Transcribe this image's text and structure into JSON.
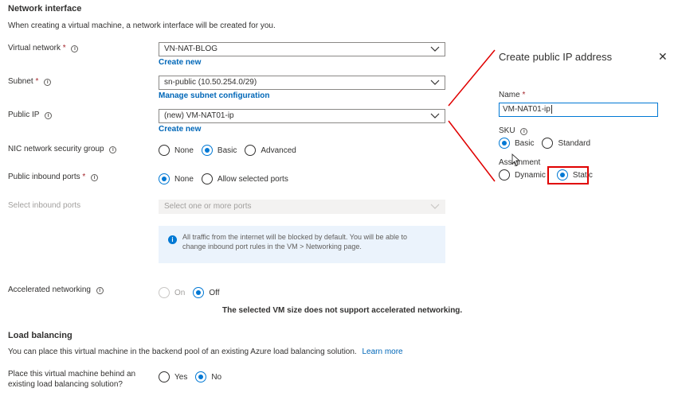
{
  "network_interface": {
    "title": "Network interface",
    "description": "When creating a virtual machine, a network interface will be created for you."
  },
  "virtual_network": {
    "label": "Virtual network",
    "required": "*",
    "value": "VN-NAT-BLOG",
    "link": "Create new"
  },
  "subnet": {
    "label": "Subnet",
    "required": "*",
    "value": "sn-public (10.50.254.0/29)",
    "link": "Manage subnet configuration"
  },
  "public_ip": {
    "label": "Public IP",
    "value": "(new) VM-NAT01-ip",
    "link": "Create new"
  },
  "nic_nsg": {
    "label": "NIC network security group",
    "options": [
      "None",
      "Basic",
      "Advanced"
    ],
    "selected": "Basic"
  },
  "public_inbound_ports": {
    "label": "Public inbound ports",
    "required": "*",
    "options": [
      "None",
      "Allow selected ports"
    ],
    "selected": "None"
  },
  "select_inbound_ports": {
    "label": "Select inbound ports",
    "placeholder": "Select one or more ports"
  },
  "info_box": {
    "line1": "All traffic from the internet will be blocked by default. You will be able to",
    "line2": "change inbound port rules in the VM > Networking page."
  },
  "accelerated_networking": {
    "label": "Accelerated networking",
    "options": [
      "On",
      "Off"
    ],
    "selected": "Off",
    "note": "The selected VM size does not support accelerated networking."
  },
  "load_balancing": {
    "title": "Load balancing",
    "description": "You can place this virtual machine in the backend pool of an existing Azure load balancing solution.",
    "learn_more": "Learn more",
    "question_line1": "Place this virtual machine behind an",
    "question_line2": "existing load balancing solution?",
    "options": [
      "Yes",
      "No"
    ],
    "selected": "No"
  },
  "panel": {
    "title": "Create public IP address",
    "name_label": "Name",
    "name_required": "*",
    "name_value": "VM-NAT01-ip",
    "sku_label": "SKU",
    "sku_options": [
      "Basic",
      "Standard"
    ],
    "sku_selected": "Basic",
    "assignment_label": "Assignment",
    "assignment_options": [
      "Dynamic",
      "Static"
    ],
    "assignment_selected": "Static"
  },
  "colors": {
    "accent": "#0078d4",
    "link": "#0067b8",
    "annotation": "#e00000"
  },
  "icons": [
    "info-icon",
    "chevron-down-icon",
    "close-icon",
    "info-filled-icon",
    "mouse-cursor-icon"
  ]
}
